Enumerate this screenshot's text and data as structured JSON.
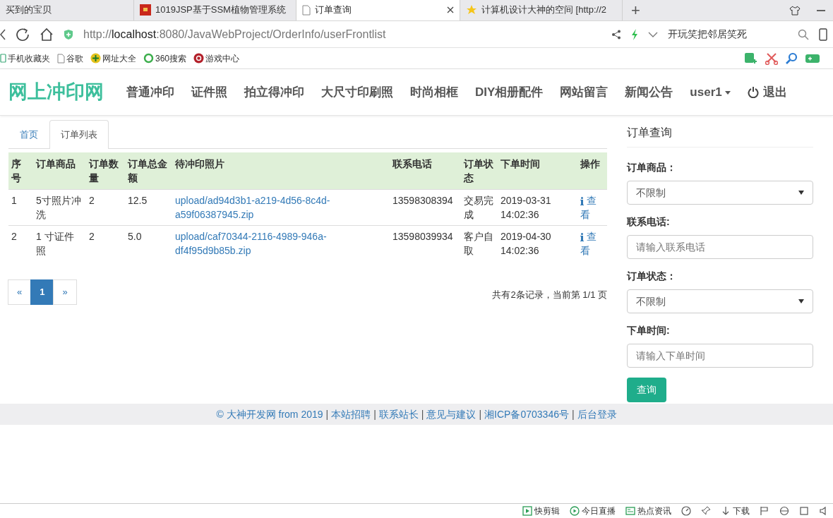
{
  "browser": {
    "tabs": [
      {
        "title": "买到的宝贝",
        "selected": false
      },
      {
        "title": "1019JSP基于SSM植物管理系统",
        "selected": false
      },
      {
        "title": "订单查询",
        "selected": true
      },
      {
        "title": "计算机设计大神的空间 [http://2",
        "selected": false
      }
    ],
    "new_tab": "+",
    "url": {
      "scheme": "http://",
      "host": "localhost",
      "rest": ":8080/JavaWebProject/OrderInfo/userFrontlist"
    },
    "search_value": "开玩笑把邻居笑死",
    "bookmarks": [
      "手机收藏夹",
      "谷歌",
      "网址大全",
      "360搜索",
      "游戏中心"
    ]
  },
  "site": {
    "brand": "网上冲印网",
    "nav": [
      "普通冲印",
      "证件照",
      "拍立得冲印",
      "大尺寸印刷照",
      "时尚相框",
      "DIY相册配件",
      "网站留言",
      "新闻公告"
    ],
    "user": "user1",
    "logout": "退出"
  },
  "content_tabs": [
    {
      "label": "首页",
      "selected": false
    },
    {
      "label": "订单列表",
      "selected": true
    }
  ],
  "table": {
    "columns": [
      "序号",
      "订单商品",
      "订单数量",
      "订单总金额",
      "待冲印照片",
      "联系电话",
      "订单状态",
      "下单时间",
      "操作"
    ],
    "rows": [
      {
        "cells": [
          "1",
          "5寸照片冲洗",
          "2",
          "12.5",
          "upload/ad94d3b1-a219-4d56-8c4d-a59f06387945.zip",
          "13598308394",
          "交易完成",
          "2019-03-31 14:02:36"
        ],
        "action": "查看"
      },
      {
        "cells": [
          "2",
          "1 寸证件照",
          "2",
          "5.0",
          "upload/caf70344-2116-4989-946a-df4f95d9b85b.zip",
          "13598039934",
          "客户自取",
          "2019-04-30 14:02:36"
        ],
        "action": "查看"
      }
    ]
  },
  "pagination": {
    "prev": "«",
    "next": "»",
    "pages": [
      {
        "label": "1",
        "selected": true
      }
    ]
  },
  "record_info": "共有2条记录，当前第 1/1 页",
  "query": {
    "title": "订单查询",
    "fields": [
      {
        "kind": "select",
        "label": "订单商品：",
        "value": "不限制"
      },
      {
        "kind": "text",
        "label": "联系电话:",
        "placeholder": "请输入联系电话"
      },
      {
        "kind": "select",
        "label": "订单状态：",
        "value": "不限制"
      },
      {
        "kind": "text",
        "label": "下单时间:",
        "placeholder": "请输入下单时间"
      }
    ],
    "button": "查询"
  },
  "footer": {
    "separator": "|",
    "items": [
      "© 大神开发网 from 2019",
      "本站招聘",
      "联系站长",
      "意见与建议",
      "湘ICP备0703346号",
      "后台登录"
    ]
  },
  "status_bar": [
    "快剪辑",
    "今日直播",
    "热点资讯",
    "下载"
  ]
}
